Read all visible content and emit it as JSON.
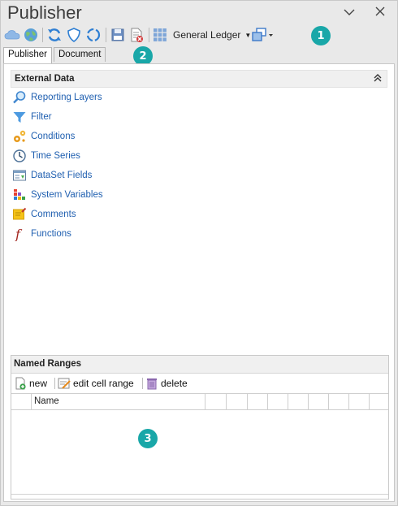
{
  "window": {
    "title": "Publisher",
    "controls": [
      "chevron-down-icon",
      "close-icon"
    ]
  },
  "toolbar": {
    "icons": [
      "cloud-icon",
      "globe-icon",
      "refresh-icon",
      "shield-icon",
      "sync-icon",
      "save-icon",
      "delete-document-icon",
      "grid-icon",
      "window-add-icon"
    ],
    "ledger_label": "General Ledger"
  },
  "badges": {
    "one": "1",
    "two": "2",
    "three": "3"
  },
  "tabs": [
    {
      "label": "Publisher",
      "active": true
    },
    {
      "label": "Document",
      "active": false
    }
  ],
  "external_data": {
    "header": "External Data",
    "collapse_glyph": "˄",
    "items": [
      {
        "label": "Reporting Layers",
        "icon": "search-icon"
      },
      {
        "label": "Filter",
        "icon": "filter-icon"
      },
      {
        "label": "Conditions",
        "icon": "gears-icon"
      },
      {
        "label": "Time Series",
        "icon": "clock-icon"
      },
      {
        "label": "DataSet Fields",
        "icon": "dataset-icon"
      },
      {
        "label": "System Variables",
        "icon": "variables-icon"
      },
      {
        "label": "Comments",
        "icon": "comment-icon"
      },
      {
        "label": "Functions",
        "icon": "function-icon"
      }
    ]
  },
  "named_ranges": {
    "header": "Named Ranges",
    "buttons": {
      "new": "new",
      "edit": "edit cell range",
      "delete": "delete"
    },
    "columns": [
      "Name"
    ]
  },
  "colors": {
    "accent": "#19a7a8",
    "link": "#1f5fb0"
  }
}
